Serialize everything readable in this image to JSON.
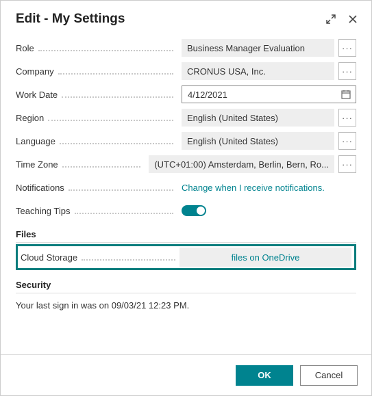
{
  "header": {
    "title": "Edit - My Settings"
  },
  "fields": {
    "role": {
      "label": "Role",
      "value": "Business Manager Evaluation"
    },
    "company": {
      "label": "Company",
      "value": "CRONUS USA, Inc."
    },
    "workDate": {
      "label": "Work Date",
      "value": "4/12/2021"
    },
    "region": {
      "label": "Region",
      "value": "English (United States)"
    },
    "language": {
      "label": "Language",
      "value": "English (United States)"
    },
    "timeZone": {
      "label": "Time Zone",
      "value": "(UTC+01:00) Amsterdam, Berlin, Bern, Ro..."
    },
    "notifications": {
      "label": "Notifications",
      "link": "Change when I receive notifications."
    },
    "teachingTips": {
      "label": "Teaching Tips",
      "on": true
    }
  },
  "sections": {
    "files": {
      "title": "Files",
      "cloudStorage": {
        "label": "Cloud Storage",
        "button": "files on OneDrive"
      }
    },
    "security": {
      "title": "Security",
      "lastSignIn": "Your last sign in was on 09/03/21 12:23 PM."
    }
  },
  "footer": {
    "ok": "OK",
    "cancel": "Cancel"
  },
  "glyphs": {
    "more": "···"
  }
}
